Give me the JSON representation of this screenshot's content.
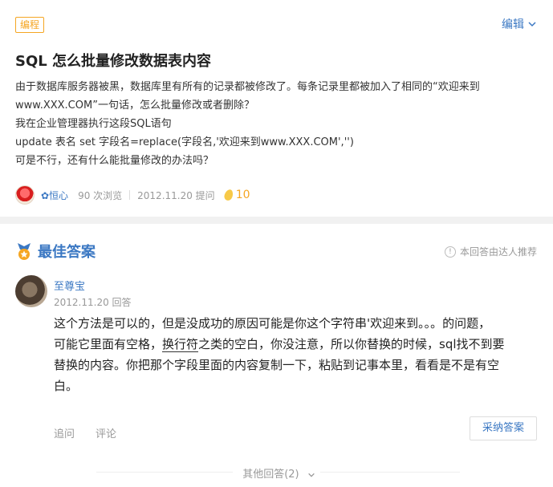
{
  "question": {
    "tag": "编程",
    "edit_label": "编辑",
    "title": "SQL 怎么批量修改数据表内容",
    "body_lines": [
      "由于数据库服务器被黑，数据库里有所有的记录都被修改了。每条记录里都被加入了相同的“欢迎来到",
      "www.XXX.COM”一句话，怎么批量修改或者删除？",
      "我在企业管理器执行这段SQL语句",
      "update 表名 set 字段名=replace(字段名,'欢迎来到www.XXX.COM','')",
      "可是不行，还有什么能批量修改的办法吗？"
    ],
    "asker": "✿恒心",
    "views": "90 次浏览",
    "asked_date": "2012.11.20 提问",
    "reward": "10"
  },
  "best_answer": {
    "title": "最佳答案",
    "recommend_note": "本回答由达人推荐",
    "user": "至尊宝",
    "date": "2012.11.20 回答",
    "line1": "这个方法是可以的，但是没成功的原因可能是你这个字符串'欢迎来到。。。的问题，",
    "line2_before": "可能它里面有空格，",
    "line2_underline": "换行符",
    "line2_after": "之类的空白，你没注意，所以你替换的时候，sql找不到要",
    "line3": "替换的内容。你把那个字段里面的内容复制一下，粘贴到记事本里，看看是不是有空",
    "line4": "白。",
    "followup_label": "追问",
    "comment_label": "评论",
    "accept_label": "采纳答案"
  },
  "others_label": "其他回答(2)",
  "colors": {
    "accent": "#3b78c3",
    "tag_orange": "#f5a623",
    "muted": "#999999"
  }
}
